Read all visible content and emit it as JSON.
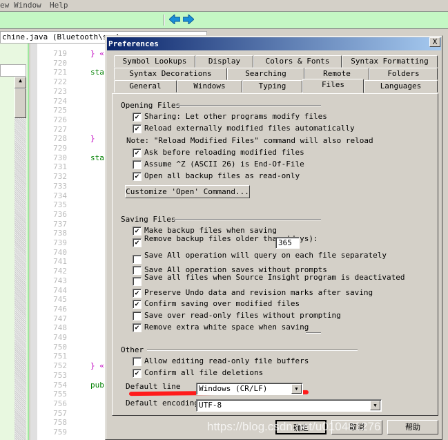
{
  "menubar": {
    "items": [
      "ew",
      "Window",
      "Help"
    ]
  },
  "editor": {
    "file_tab": "chine.java (Bluetooth\\src\\",
    "line_numbers": [
      719,
      720,
      721,
      722,
      723,
      724,
      725,
      726,
      727,
      728,
      729,
      730,
      731,
      732,
      733,
      734,
      735,
      736,
      737,
      738,
      739,
      740,
      741,
      742,
      743,
      744,
      745,
      746,
      747,
      748,
      749,
      750,
      751,
      752,
      753,
      754,
      755,
      756,
      757,
      758,
      759
    ],
    "code": [
      {
        "line": 719,
        "text": "} «",
        "color": "#c000c0"
      },
      {
        "line": 721,
        "text": "sta",
        "color": "#008000"
      },
      {
        "line": 728,
        "text": "}",
        "color": "#c000c0"
      },
      {
        "line": 730,
        "text": "sta",
        "color": "#008000"
      },
      {
        "line": 752,
        "text": "} «",
        "color": "#c000c0"
      },
      {
        "line": 754,
        "text": "pub",
        "color": "#008000"
      }
    ]
  },
  "toolbar": {
    "back_icon": "arrow-left-icon",
    "forward_icon": "arrow-right-icon"
  },
  "dialog": {
    "title": "Preferences",
    "close": "X",
    "tabs_row1": [
      "Symbol Lookups",
      "Display",
      "Colors & Fonts",
      "Syntax Formatting"
    ],
    "tabs_row2": [
      "Syntax Decorations",
      "Searching",
      "Remote",
      "Folders"
    ],
    "tabs_row3": [
      "General",
      "Windows",
      "Typing",
      "Files",
      "Languages"
    ],
    "selected_tab": "Files",
    "opening": {
      "title": "Opening Files",
      "items": [
        {
          "label": "Sharing: Let other programs modify files",
          "checked": true
        },
        {
          "label": "Reload externally modified files automatically",
          "checked": true
        },
        {
          "label": "Ask before reloading modified files",
          "checked": true
        },
        {
          "label": "Assume ^Z (ASCII 26) is End-Of-File",
          "checked": false
        },
        {
          "label": "Open all backup files as read-only",
          "checked": true
        }
      ],
      "note": "Note: \"Reload Modified Files\" command will also reload",
      "customize": "Customize 'Open' Command..."
    },
    "saving": {
      "title": "Saving Files",
      "items": [
        {
          "label": "Make backup files when saving",
          "checked": true
        },
        {
          "label": "Remove backup files older than (days):",
          "checked": true
        },
        {
          "label": "Save All operation will query on each file separately",
          "checked": false
        },
        {
          "label": "Save All operation saves without prompts",
          "checked": false
        },
        {
          "label": "Save all files when Source Insight program is deactivated",
          "checked": false
        },
        {
          "label": "Preserve Undo data and revision marks after saving",
          "checked": true
        },
        {
          "label": "Confirm saving over modified files",
          "checked": true
        },
        {
          "label": "Save over read-only files without prompting",
          "checked": false
        },
        {
          "label": "Remove extra white space when saving",
          "checked": true
        }
      ],
      "days": "365"
    },
    "other": {
      "title": "Other",
      "items": [
        {
          "label": "Allow editing read-only file buffers",
          "checked": false
        },
        {
          "label": "Confirm all file deletions",
          "checked": true
        }
      ],
      "line_label": "Default line",
      "line_value": "Windows (CR/LF)",
      "encoding_label": "Default encoding:",
      "encoding_value": "UTF-8"
    },
    "buttons": {
      "ok": "确定",
      "cancel": "取消",
      "help": "帮助"
    }
  },
  "watermark": "https://blog.csdn.net/u010481276",
  "colors": {
    "highlight": "#ff1a1a",
    "title_start": "#0a246a",
    "title_end": "#a6caf0"
  }
}
